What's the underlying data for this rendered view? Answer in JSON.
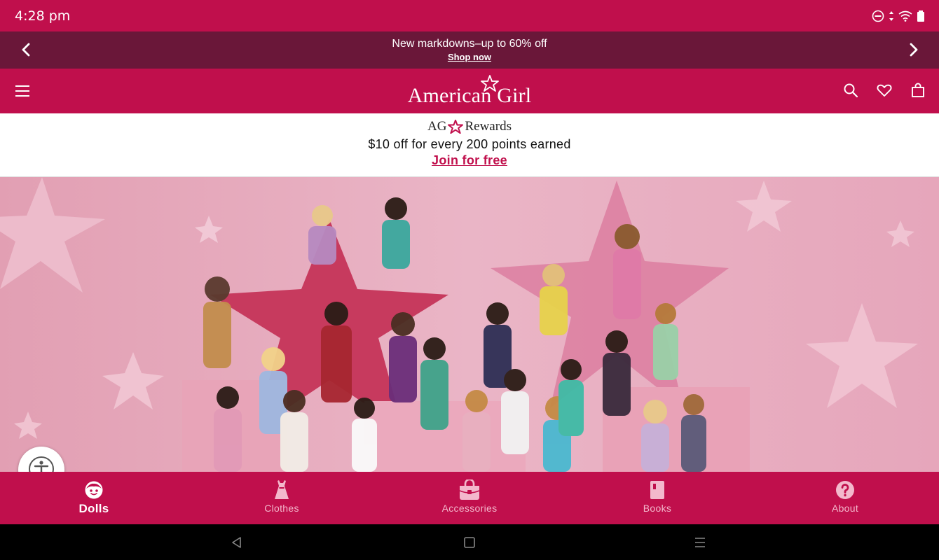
{
  "status_bar": {
    "time": "4:28 pm",
    "icons": [
      "do-not-disturb-icon",
      "data-arrows-icon",
      "wifi-icon",
      "battery-icon"
    ]
  },
  "promo": {
    "headline": "New markdowns–up to 60% off",
    "link": "Shop now"
  },
  "header": {
    "logo_text": "American Girl",
    "actions": [
      "search-icon",
      "heart-icon",
      "shopping-bag-icon"
    ]
  },
  "rewards": {
    "logo_left": "AG",
    "logo_right": "Rewards",
    "text": "$10 off for every 200 points earned",
    "link": "Join for free"
  },
  "bottom_nav": {
    "items": [
      {
        "label": "Dolls",
        "icon": "doll-face-icon",
        "active": true
      },
      {
        "label": "Clothes",
        "icon": "dress-icon",
        "active": false
      },
      {
        "label": "Accessories",
        "icon": "bag-icon",
        "active": false
      },
      {
        "label": "Books",
        "icon": "book-icon",
        "active": false
      },
      {
        "label": "About",
        "icon": "help-icon",
        "active": false
      }
    ]
  },
  "colors": {
    "brand": "#c00f4c",
    "promo_bg": "#6a1739",
    "hero_bg": "#e7a9bd",
    "nav_inactive": "#f3b8cc"
  }
}
